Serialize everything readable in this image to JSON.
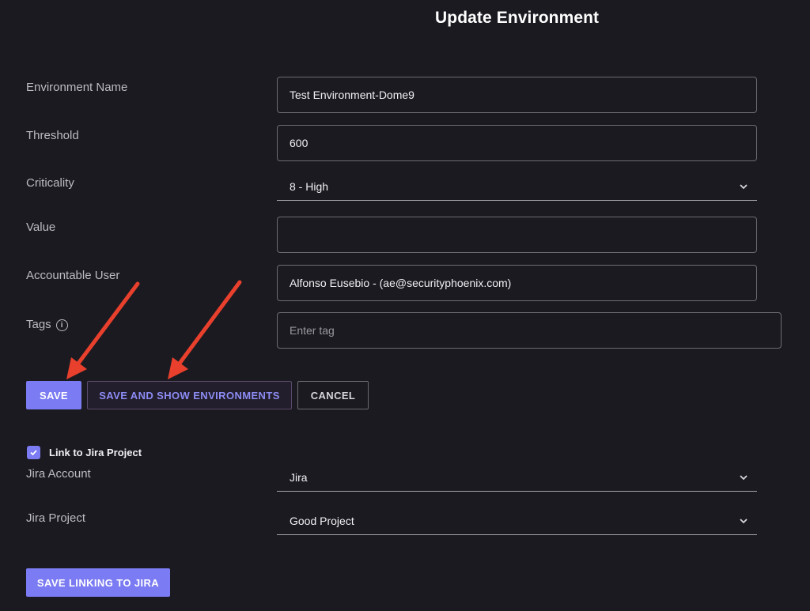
{
  "page": {
    "title": "Update Environment"
  },
  "form": {
    "environment_name": {
      "label": "Environment Name",
      "value": "Test Environment-Dome9"
    },
    "threshold": {
      "label": "Threshold",
      "value": "600"
    },
    "criticality": {
      "label": "Criticality",
      "selected": "8 - High"
    },
    "value_field": {
      "label": "Value",
      "value": ""
    },
    "accountable_user": {
      "label": "Accountable User",
      "value": "Alfonso Eusebio - (ae@securityphoenix.com)"
    },
    "tags": {
      "label": "Tags",
      "placeholder": "Enter tag",
      "info_icon": "i"
    }
  },
  "actions": {
    "save": "SAVE",
    "save_and_show": "SAVE AND SHOW ENVIRONMENTS",
    "cancel": "CANCEL"
  },
  "jira": {
    "link_label": "Link to Jira Project",
    "link_checked": true,
    "account": {
      "label": "Jira Account",
      "selected": "Jira"
    },
    "project": {
      "label": "Jira Project",
      "selected": "Good Project"
    },
    "save_linking": "SAVE LINKING TO JIRA"
  },
  "colors": {
    "background": "#1b1a20",
    "accent": "#7b7bf3",
    "annotation_arrow": "#e8402d"
  }
}
